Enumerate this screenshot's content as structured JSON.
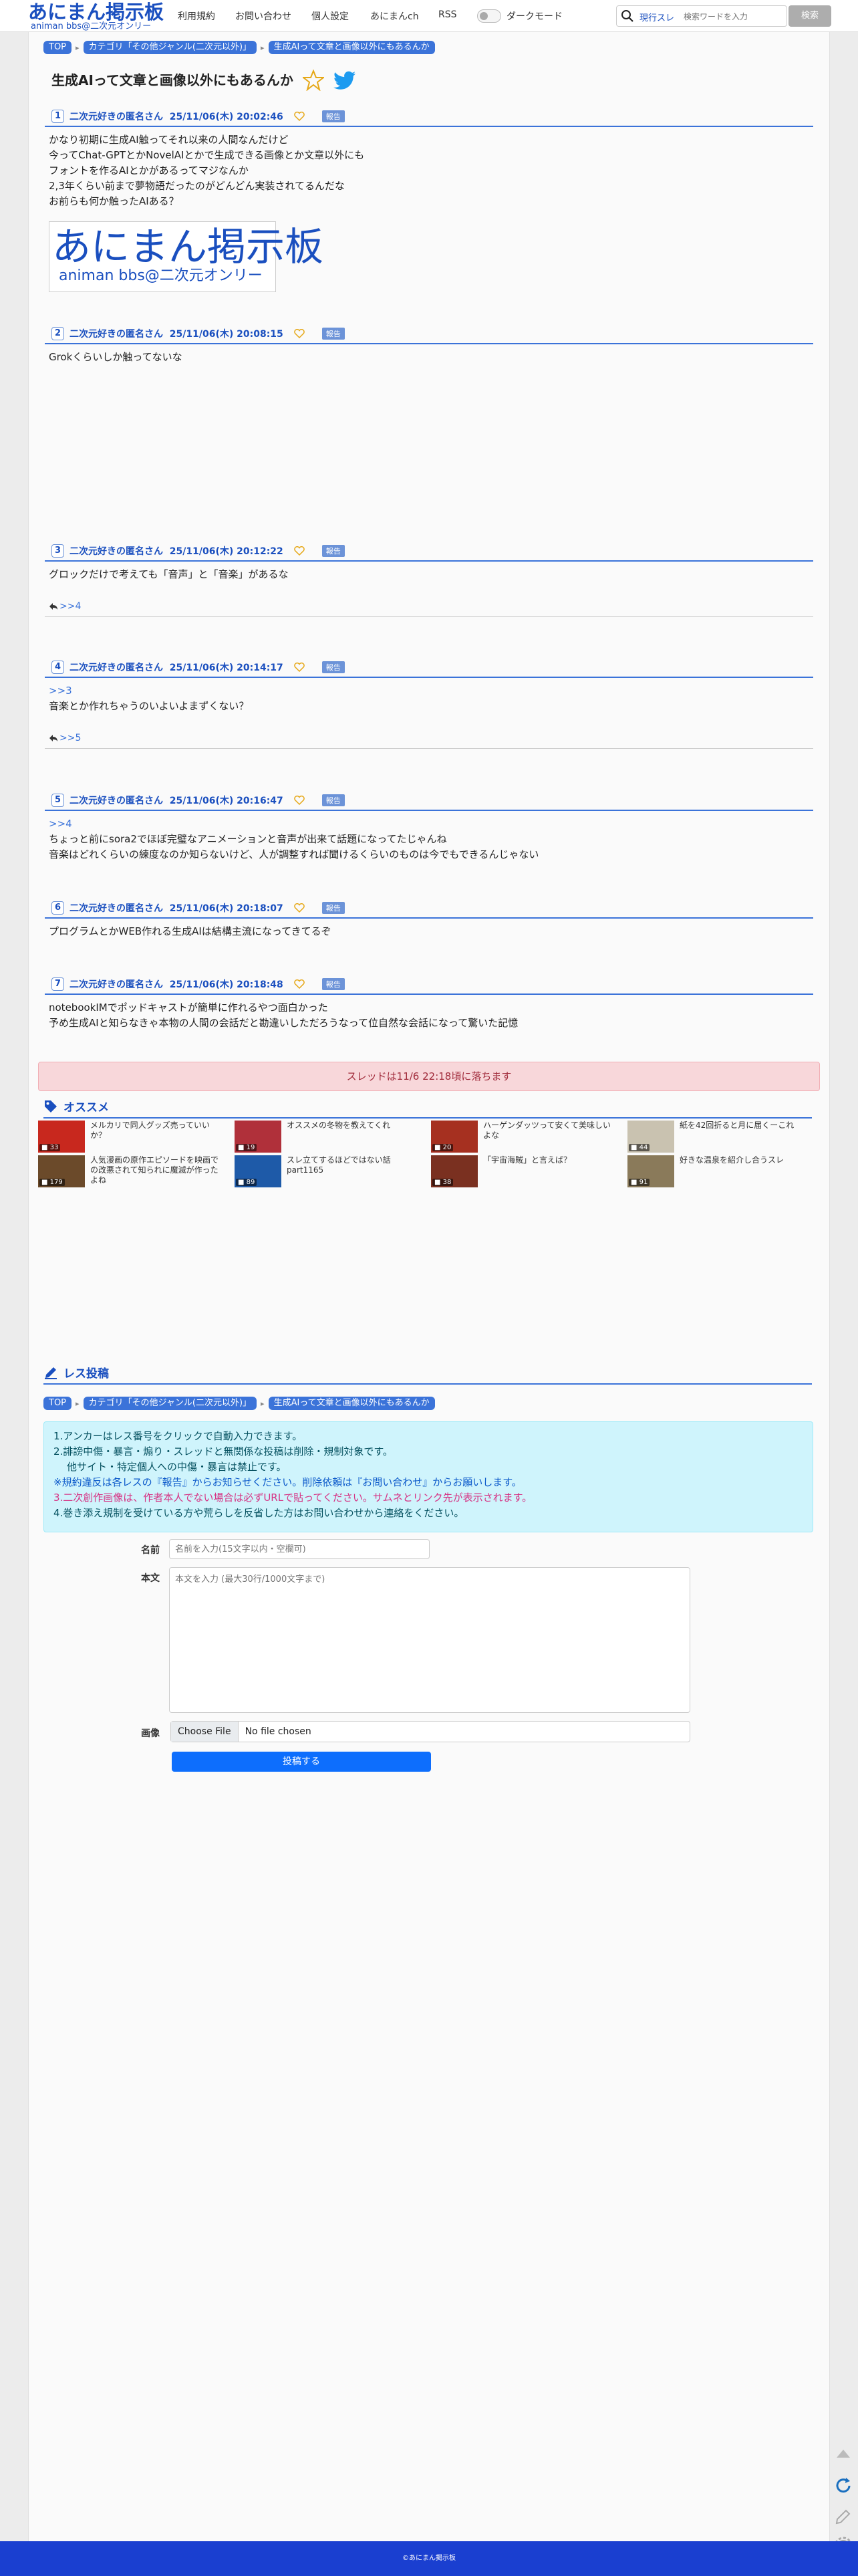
{
  "header": {
    "logo_main": "あにまん掲示板",
    "logo_sub": "animan bbs@二次元オンリー",
    "nav": [
      "利用規約",
      "お問い合わせ",
      "個人設定",
      "あにまんch",
      "RSS"
    ],
    "dark_mode_label": "ダークモード",
    "search_type": "現行スレ",
    "search_placeholder": "検索ワードを入力",
    "search_button": "検索"
  },
  "breadcrumb": {
    "top": "TOP",
    "category": "カテゴリ「その他ジャンル(二次元以外)」",
    "thread": "生成AIって文章と画像以外にもあるんか"
  },
  "thread": {
    "title": "生成AIって文章と画像以外にもあるんか",
    "report_label": "報告",
    "posts": [
      {
        "num": "1",
        "name": "二次元好きの匿名さん",
        "date": "25/11/06(木) 20:02:46",
        "body": "かなり初期に生成AI触ってそれ以来の人間なんだけど\n今ってChat-GPTとかNovelAIとかで生成できる画像とか文章以外にも\nフォントを作るAIとかがあるってマジなんか\n2,3年くらい前まで夢物語だったのがどんどん実装されてるんだな\nお前らも何か触ったAIある？",
        "image_main": "あにまん掲示板",
        "image_sub": "animan bbs@二次元オンリー"
      },
      {
        "num": "2",
        "name": "二次元好きの匿名さん",
        "date": "25/11/06(木) 20:08:15",
        "body": "Grokくらいしか触ってないな"
      },
      {
        "num": "3",
        "name": "二次元好きの匿名さん",
        "date": "25/11/06(木) 20:12:22",
        "body": "グロックだけで考えても「音声」と「音楽」があるな",
        "reply": ">>4"
      },
      {
        "num": "4",
        "name": "二次元好きの匿名さん",
        "date": "25/11/06(木) 20:14:17",
        "anchor": ">>3",
        "body": "音楽とか作れちゃうのいよいよまずくない？",
        "reply": ">>5"
      },
      {
        "num": "5",
        "name": "二次元好きの匿名さん",
        "date": "25/11/06(木) 20:16:47",
        "anchor": ">>4",
        "body": "ちょっと前にsora2でほぼ完璧なアニメーションと音声が出来て話題になってたじゃんね\n音楽はどれくらいの練度なのか知らないけど、人が調整すれば聞けるくらいのものは今でもできるんじゃない"
      },
      {
        "num": "6",
        "name": "二次元好きの匿名さん",
        "date": "25/11/06(木) 20:18:07",
        "body": "プログラムとかWEB作れる生成AIは結構主流になってきてるぞ"
      },
      {
        "num": "7",
        "name": "二次元好きの匿名さん",
        "date": "25/11/06(木) 20:18:48",
        "body": "notebookIMでポッドキャストが簡単に作れるやつ面白かった\n予め生成AIと知らなきゃ本物の人間の会話だと勘違いしただろうなって位自然な会話になって驚いた記憶"
      }
    ],
    "closed_notice": "スレッドは11/6 22:18頃に落ちます"
  },
  "recommend": {
    "heading": "オススメ",
    "items": [
      {
        "text": "メルカリで同人グッズ売っていいか？",
        "count": "33",
        "color": "#c8281e"
      },
      {
        "text": "オススメの冬物を教えてくれ",
        "count": "19",
        "color": "#b0303a"
      },
      {
        "text": "ハーゲンダッツって安くて美味しいよな",
        "count": "20",
        "color": "#a63020"
      },
      {
        "text": "紙を42回折ると月に届くーこれ",
        "count": "44",
        "color": "#c9c2b0"
      },
      {
        "text": "人気漫画の原作エピソードを映画での改悪されて知られに魔滅が作ったよね",
        "count": "179",
        "color": "#6b4a2a"
      },
      {
        "text": "スレ立てするほどではない話part1165",
        "count": "89",
        "color": "#1e5aa8"
      },
      {
        "text": "「宇宙海賊」と言えば？",
        "count": "38",
        "color": "#7a3020"
      },
      {
        "text": "好きな温泉を紹介し合うスレ",
        "count": "91",
        "color": "#8a7a5a"
      }
    ]
  },
  "reply_form": {
    "heading": "レス投稿",
    "rules": [
      "1.アンカーはレス番号をクリックで自動入力できます。",
      "2.誹謗中傷・暴言・煽り・スレッドと無関係な投稿は削除・規制対象です。",
      "他サイト・特定個人への中傷・暴言は禁止です。",
      "※規約違反は各レスの『報告』からお知らせください。削除依頼は『お問い合わせ』からお願いします。",
      "3.二次創作画像は、作者本人でない場合は必ずURLで貼ってください。サムネとリンク先が表示されます。",
      "4.巻き添え規制を受けている方や荒らしを反省した方はお問い合わせから連絡をください。"
    ],
    "name_label": "名前",
    "name_placeholder": "名前を入力(15文字以内・空欄可)",
    "body_label": "本文",
    "body_placeholder": "本文を入力 (最大30行/1000文字まで)",
    "image_label": "画像",
    "file_button": "Choose File",
    "file_status": "No file chosen",
    "submit_label": "投稿する"
  },
  "footer": {
    "copyright": "©あにまん掲示板"
  }
}
